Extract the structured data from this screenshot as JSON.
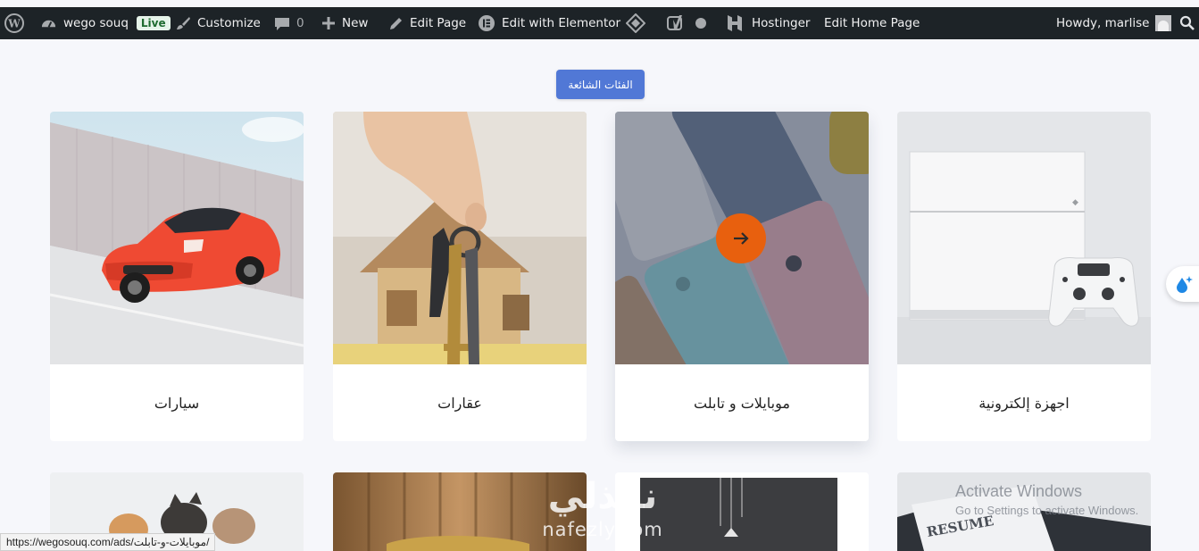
{
  "admin_bar": {
    "site_name": "wego souq",
    "live_badge": "Live",
    "customize": "Customize",
    "comments_count": "0",
    "new": "New",
    "edit_page": "Edit Page",
    "edit_with_elementor": "Edit with Elementor",
    "hostinger": "Hostinger",
    "edit_home_page": "Edit Home Page",
    "howdy": "Howdy, marlise",
    "icons": [
      "wordpress-logo-icon",
      "dashboard-icon",
      "brush-icon",
      "comment-icon",
      "plus-icon",
      "pencil-icon",
      "elementor-icon",
      "diamond-icon",
      "yoast-icon",
      "status-dot-icon",
      "hostinger-icon",
      "avatar",
      "search-icon"
    ]
  },
  "section_button": {
    "label": "الفئات الشائعة",
    "color": "#5178d6"
  },
  "categories": [
    {
      "title": "سيارات",
      "image": "red-sports-car"
    },
    {
      "title": "عقارات",
      "image": "house-keys"
    },
    {
      "title": "موبايلات و تابلت",
      "image": "colorful-phones",
      "hover_arrow_color": "#e8600e"
    },
    {
      "title": "اجهزة إلكترونية",
      "image": "game-console"
    }
  ],
  "second_row_images": [
    "kittens",
    "furniture",
    "pendant-lamps",
    "resume-paper"
  ],
  "watermark": {
    "arabic": "نفذلي",
    "latin": "nafezly.com"
  },
  "windows_activation": {
    "title": "Activate Windows",
    "subtitle": "Go to Settings to activate Windows."
  },
  "status_bar": {
    "url": "https://wegosouq.com/ads/موبايلات-و-تابلت/"
  },
  "floating_widget": {
    "icon": "water-drop-icon"
  }
}
